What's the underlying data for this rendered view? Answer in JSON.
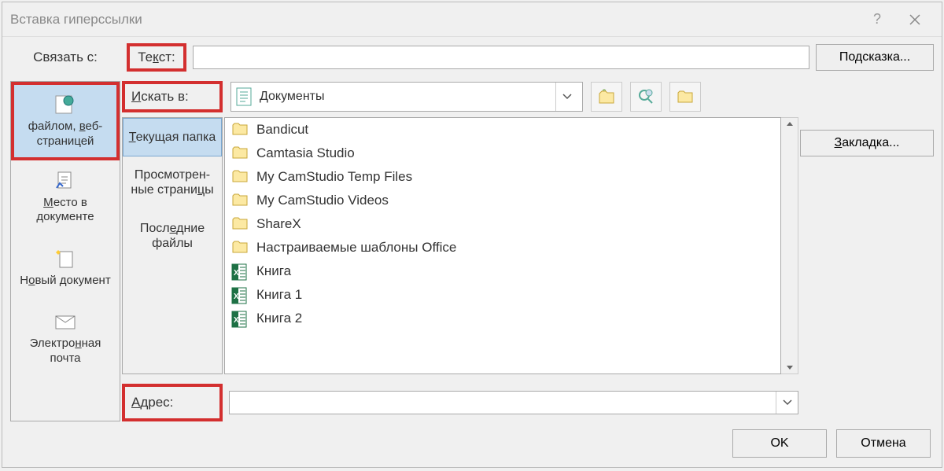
{
  "titlebar": {
    "title": "Вставка гиперссылки"
  },
  "labels": {
    "link_to": "Связать с:",
    "text": "Текст:",
    "look_in": "Искать в:",
    "address": "Адрес:"
  },
  "text_input": {
    "value": ""
  },
  "address_input": {
    "value": ""
  },
  "look_in_dropdown": {
    "selected": "Документы"
  },
  "link_types": [
    {
      "label": "файлом, веб-страницей",
      "icon": "web-file",
      "selected": true
    },
    {
      "label": "Место в документе",
      "icon": "doc-place",
      "selected": false
    },
    {
      "label": "Новый документ",
      "icon": "new-doc",
      "selected": false
    },
    {
      "label": "Электронная почта",
      "icon": "email",
      "selected": false
    }
  ],
  "subnav": [
    {
      "label": "Текущая папка",
      "selected": true
    },
    {
      "label": "Просмотрен-ные страницы",
      "selected": false
    },
    {
      "label": "Последние файлы",
      "selected": false
    }
  ],
  "files": [
    {
      "name": "Bandicut",
      "type": "folder"
    },
    {
      "name": "Camtasia Studio",
      "type": "folder"
    },
    {
      "name": "My CamStudio Temp Files",
      "type": "folder"
    },
    {
      "name": "My CamStudio Videos",
      "type": "folder"
    },
    {
      "name": "ShareX",
      "type": "folder"
    },
    {
      "name": "Настраиваемые шаблоны Office",
      "type": "folder"
    },
    {
      "name": "Книга",
      "type": "excel"
    },
    {
      "name": "Книга 1",
      "type": "excel"
    },
    {
      "name": "Книга 2",
      "type": "excel"
    }
  ],
  "buttons": {
    "hint": "Подсказка...",
    "bookmark": "Закладка...",
    "ok": "OK",
    "cancel": "Отмена"
  }
}
